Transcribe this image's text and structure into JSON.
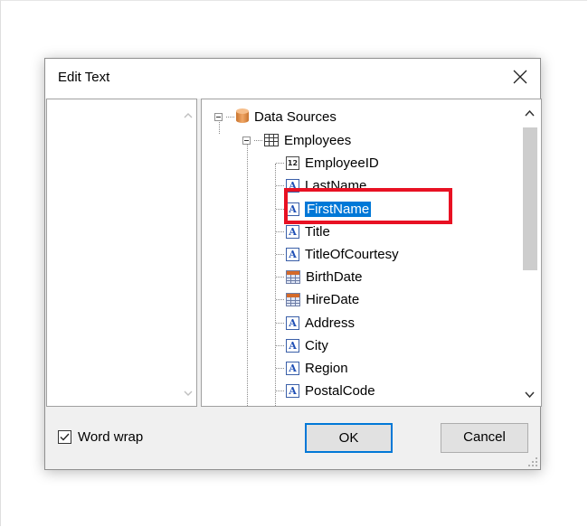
{
  "dialog": {
    "title": "Edit Text",
    "word_wrap_label": "Word wrap",
    "word_wrap_checked": true,
    "ok_label": "OK",
    "cancel_label": "Cancel"
  },
  "tree": {
    "root_label": "Data Sources",
    "table_label": "Employees",
    "fields": [
      {
        "label": "EmployeeID",
        "icon": "number-field-icon"
      },
      {
        "label": "LastName",
        "icon": "text-field-icon"
      },
      {
        "label": "FirstName",
        "icon": "text-field-icon",
        "selected": true
      },
      {
        "label": "Title",
        "icon": "text-field-icon"
      },
      {
        "label": "TitleOfCourtesy",
        "icon": "text-field-icon"
      },
      {
        "label": "BirthDate",
        "icon": "date-field-icon"
      },
      {
        "label": "HireDate",
        "icon": "date-field-icon"
      },
      {
        "label": "Address",
        "icon": "text-field-icon"
      },
      {
        "label": "City",
        "icon": "text-field-icon"
      },
      {
        "label": "Region",
        "icon": "text-field-icon"
      },
      {
        "label": "PostalCode",
        "icon": "text-field-icon"
      }
    ]
  },
  "colors": {
    "selection": "#0078d7",
    "highlight_box": "#e81123",
    "ok_border": "#0078d7"
  }
}
